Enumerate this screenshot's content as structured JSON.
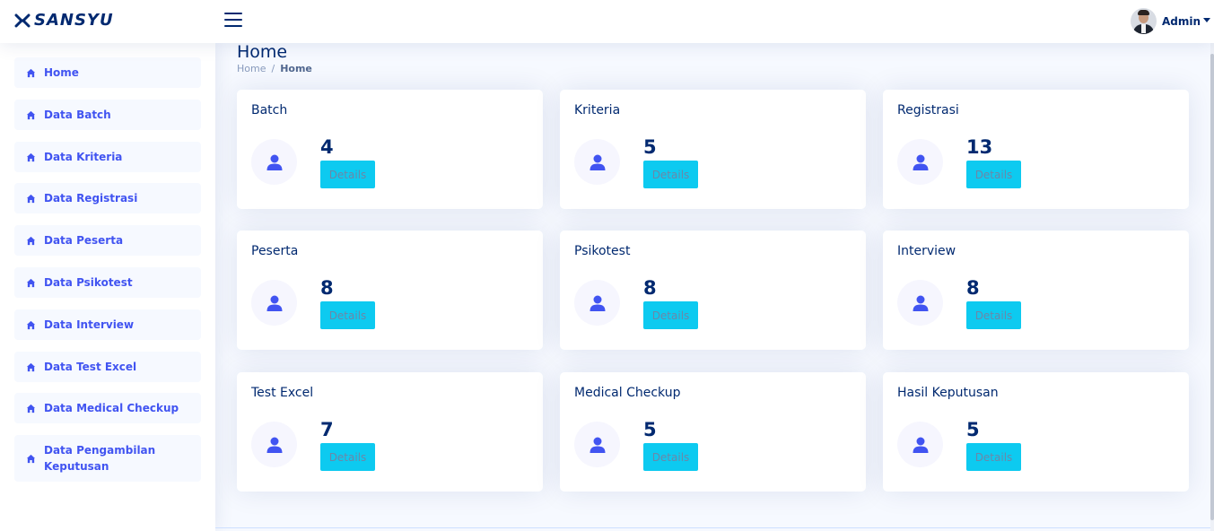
{
  "header": {
    "logo_text": "SANSYU",
    "user_name": "Admin"
  },
  "sidebar": {
    "items": [
      {
        "label": "Home",
        "icon": "home-icon"
      },
      {
        "label": "Data Batch",
        "icon": "home-icon"
      },
      {
        "label": "Data Kriteria",
        "icon": "home-icon"
      },
      {
        "label": "Data Registrasi",
        "icon": "home-icon"
      },
      {
        "label": "Data Peserta",
        "icon": "home-icon"
      },
      {
        "label": "Data Psikotest",
        "icon": "home-icon"
      },
      {
        "label": "Data Interview",
        "icon": "home-icon"
      },
      {
        "label": "Data Test Excel",
        "icon": "home-icon"
      },
      {
        "label": "Data Medical Checkup",
        "icon": "home-icon"
      },
      {
        "label": "Data Pengambilan Keputusan",
        "icon": "home-icon"
      }
    ]
  },
  "page": {
    "title": "Home",
    "breadcrumb": {
      "home": "Home",
      "separator": "/",
      "current": "Home"
    }
  },
  "cards": [
    {
      "title": "Batch",
      "count": "4",
      "button": "Details",
      "icon": "user-icon"
    },
    {
      "title": "Kriteria",
      "count": "5",
      "button": "Details",
      "icon": "user-icon"
    },
    {
      "title": "Registrasi",
      "count": "13",
      "button": "Details",
      "icon": "user-icon"
    },
    {
      "title": "Peserta",
      "count": "8",
      "button": "Details",
      "icon": "user-icon"
    },
    {
      "title": "Psikotest",
      "count": "8",
      "button": "Details",
      "icon": "user-icon"
    },
    {
      "title": "Interview",
      "count": "8",
      "button": "Details",
      "icon": "user-icon"
    },
    {
      "title": "Test Excel",
      "count": "7",
      "button": "Details",
      "icon": "user-icon"
    },
    {
      "title": "Medical Checkup",
      "count": "5",
      "button": "Details",
      "icon": "user-icon"
    },
    {
      "title": "Hasil Keputusan",
      "count": "5",
      "button": "Details",
      "icon": "user-icon"
    }
  ],
  "colors": {
    "primary": "#4154f1",
    "navy": "#012970",
    "button": "#0dcaf0",
    "background": "#f6f9ff"
  }
}
